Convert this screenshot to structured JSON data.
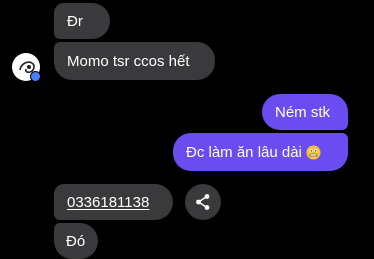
{
  "messages": [
    {
      "id": "m1",
      "direction": "incoming",
      "text": "Đr"
    },
    {
      "id": "m2",
      "direction": "incoming",
      "text": "Momo tsr ccos hết"
    },
    {
      "id": "m3",
      "direction": "outgoing",
      "text": "Ném stk"
    },
    {
      "id": "m4",
      "direction": "outgoing",
      "text": "Đc làm ăn lâu dài",
      "emoji": "grimacing-face-emoji"
    },
    {
      "id": "m5",
      "direction": "incoming",
      "text": "0336181138",
      "link": true
    },
    {
      "id": "m6",
      "direction": "incoming",
      "text": "Đó"
    }
  ],
  "icons": {
    "avatar": "contact-avatar-icon",
    "share": "share-icon"
  },
  "colors": {
    "background": "#000000",
    "incoming_bubble": "#3a3a3c",
    "outgoing_bubble": "#6b4cf0",
    "text": "#ffffff"
  }
}
